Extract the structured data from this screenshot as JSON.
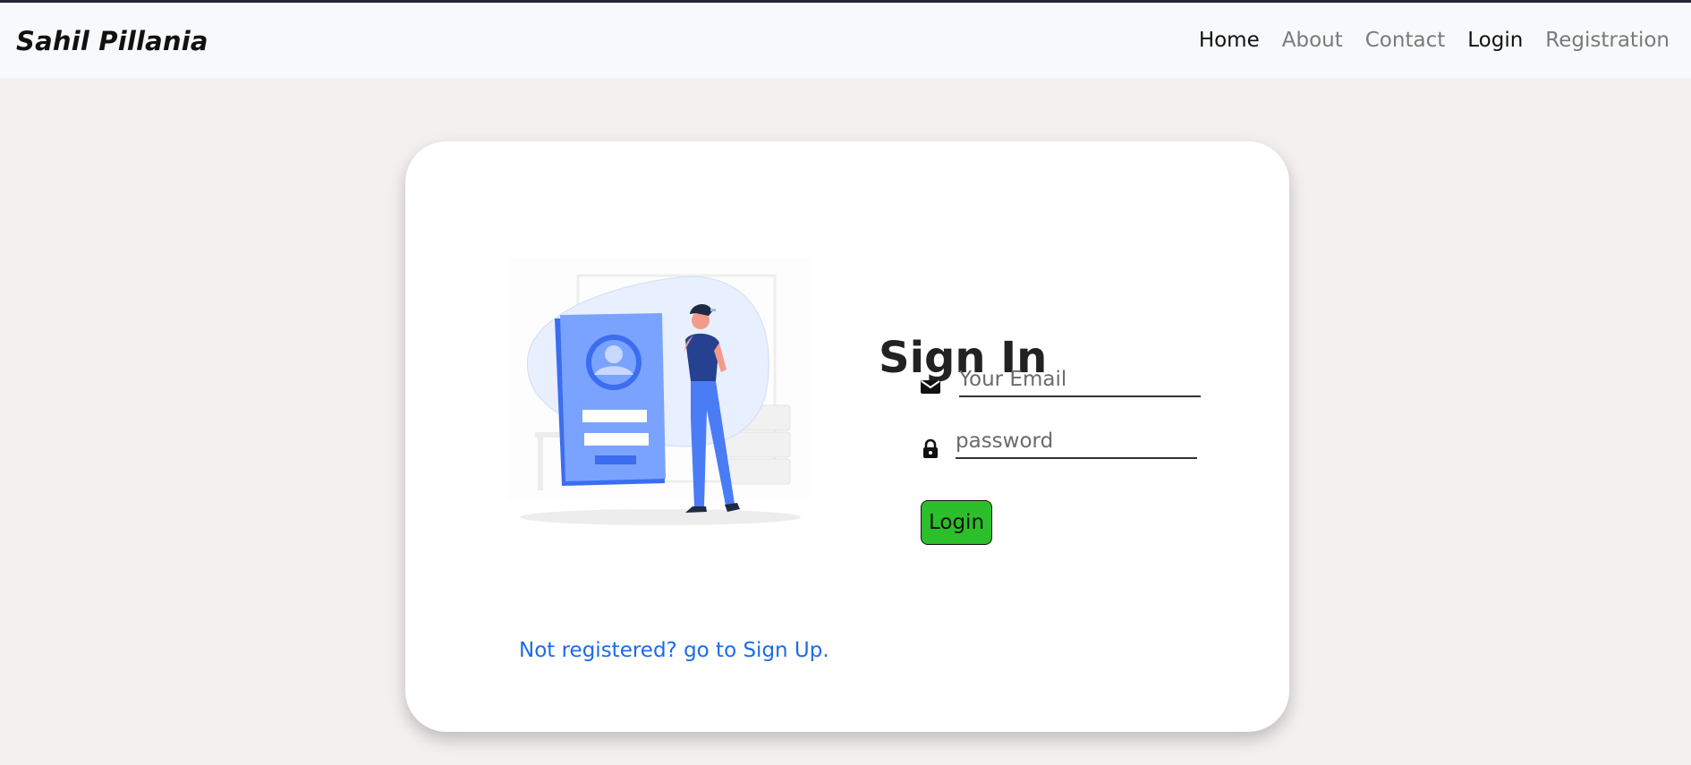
{
  "nav": {
    "brand": "Sahil Pillania",
    "links": [
      "Home",
      "About",
      "Contact",
      "Login",
      "Registration"
    ]
  },
  "signin": {
    "title": "Sign In",
    "email_placeholder": "Your Email",
    "password_placeholder": "password",
    "login_label": "Login",
    "signup_link": "Not registered? go to Sign Up."
  },
  "icons": {
    "email": "envelope-icon",
    "password": "lock-icon"
  },
  "colors": {
    "page_bg": "#f3f0ef",
    "nav_bg": "#f8f9fa",
    "button_green": "#2cbf2c",
    "link_blue": "#1a6ce8",
    "illus_blue": "#5b8cff"
  }
}
